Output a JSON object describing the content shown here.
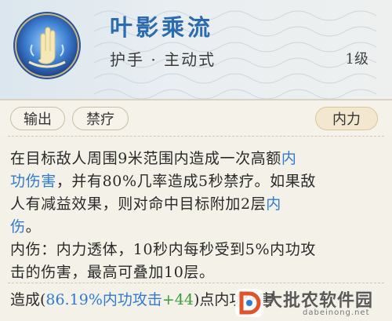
{
  "skill": {
    "name": "叶影乘流",
    "subtitle": "护手 · 主动式",
    "level": "1级",
    "icon": "hand-lotus-emblem-icon"
  },
  "tags": {
    "left": [
      "输出",
      "禁疗"
    ],
    "right": "内力"
  },
  "description": {
    "line1_a": "在目标敌人周围9米范围内造成一次高额",
    "line1_b": "内",
    "line2_a": "功伤害",
    "line2_b": "，并有80%几率造成5秒禁疗。如果敌",
    "line3_a": "人有减益效果，则对命中目标附加2层",
    "line3_b": "内",
    "line4": "伤",
    "line4_end": "。",
    "note_line1": "内伤：内力透体，10秒内每秒受到5%内功攻",
    "note_line2": "击的伤害，最高可叠加10层。"
  },
  "effect": {
    "prefix": "造成(",
    "percent": "86.19%内功攻击",
    "bonus": "+44",
    "suffix": ")点内功伤害"
  },
  "watermark": {
    "text": "大批农软件园",
    "url": "dabeinong.net"
  },
  "colors": {
    "title_blue": "#2b6cb0",
    "highlight_blue": "#2f7bd2",
    "bonus_green": "#3a9d3a",
    "background": "#f4f1e8"
  }
}
